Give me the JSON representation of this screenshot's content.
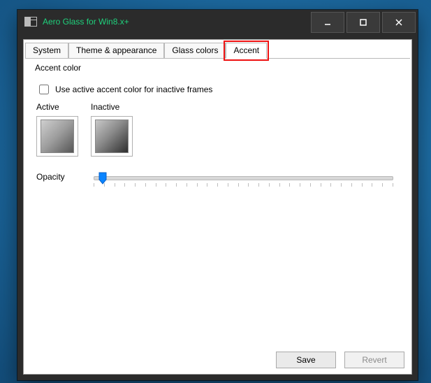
{
  "window": {
    "title": "Aero Glass for Win8.x+",
    "title_color": "#1fd17c"
  },
  "tabs": {
    "items": [
      {
        "label": "System"
      },
      {
        "label": "Theme & appearance"
      },
      {
        "label": "Glass colors"
      },
      {
        "label": "Accent"
      }
    ],
    "active_index": 3,
    "highlight_index": 3
  },
  "accent": {
    "group_label": "Accent color",
    "use_inactive_checkbox_label": "Use active accent color for inactive frames",
    "use_inactive_checked": false,
    "active_label": "Active",
    "inactive_label": "Inactive",
    "opacity_label": "Opacity",
    "opacity_value_percent": 3,
    "tick_count": 30
  },
  "footer": {
    "save_label": "Save",
    "revert_label": "Revert",
    "revert_enabled": false
  }
}
